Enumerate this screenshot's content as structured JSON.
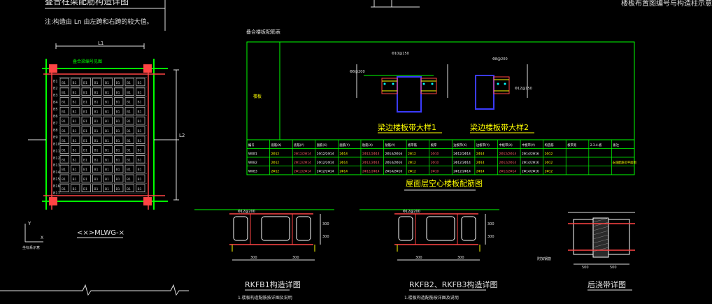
{
  "header": {
    "left_title": "叠合柱梁配筋构造详图",
    "left_note": "注:构造由 Ln 由左跨和右跨的较大值。",
    "right_title": "楼板布置图编号与构造柱示意图"
  },
  "left_plan": {
    "dim_top": "L1",
    "dim_side": "L2",
    "beam_label": "叠合梁编号见图",
    "caption": "<×>MLWG-×",
    "axis_y": "Y",
    "axis_x": "X",
    "axis_caption": "坐标系示意",
    "row_labels": [
      "B1",
      "B2",
      "B3",
      "B4",
      "B5",
      "B6",
      "B7",
      "B8",
      "B9",
      "B10",
      "B11",
      "B12",
      "B13",
      "B14",
      "B15",
      "B16",
      "B17"
    ],
    "cell_mark": "B1"
  },
  "table": {
    "caption": "叠合楼板配筋表",
    "left_cell": "楼板",
    "detail1_caption": "梁边楼板带大样1",
    "detail2_caption": "梁边楼板带大样2",
    "detail_notes": [
      "Φ8@200",
      "Φ10@150",
      "Φ12@150",
      "Φ8@200"
    ],
    "title": "屋面层空心楼板配筋图",
    "header_cells": [
      "编号",
      "底筋(X)",
      "底筋(Y)",
      "面筋(X)",
      "面筋(Y)",
      "肋筋(X)",
      "肋筋(Y)",
      "板带筋",
      "板厚",
      "边板带(X)",
      "边板带(Y)",
      "中板带(X)",
      "中板带(Y)",
      "构造筋",
      "板带宽",
      "2.3.4.板",
      "备注"
    ],
    "rows": [
      [
        "WKB1",
        "2Φ12",
        "2Φ12/2Φ14",
        "2Φ12/2Φ14",
        "2Φ14",
        "2Φ12/2Φ14",
        "2Φ14/2Φ16",
        "2Φ12",
        "2Φ10",
        "2Φ12/2Φ14",
        "2Φ14",
        "2Φ12/2Φ14",
        "2Φ14/2Φ16",
        "2Φ12"
      ],
      [
        "WKB2",
        "2Φ12",
        "2Φ12/2Φ14",
        "2Φ12/2Φ14",
        "2Φ14",
        "2Φ12/2Φ14",
        "2Φ14/2Φ16",
        "2Φ12",
        "2Φ10",
        "2Φ12/2Φ14",
        "2Φ14",
        "2Φ12/2Φ14",
        "2Φ14/2Φ16",
        "2Φ12"
      ],
      [
        "WKB3",
        "2Φ12",
        "2Φ12/2Φ14",
        "2Φ12/2Φ14",
        "2Φ14",
        "2Φ12/2Φ14",
        "2Φ14/2Φ16",
        "2Φ12",
        "2Φ10",
        "2Φ12/2Φ14",
        "2Φ14",
        "2Φ12/2Φ14",
        "2Φ14/2Φ16",
        "2Φ12"
      ]
    ],
    "remark": "支座配筋见平面图"
  },
  "sections": [
    {
      "title": "RKFB1构造详图",
      "note": "1.楼板构造配筋按详图及说明",
      "dims": [
        "300",
        "300",
        "300",
        "300"
      ],
      "label": "Φ12@200"
    },
    {
      "title": "RKFB2、RKFB3构造详图",
      "note": "1.楼板构造配筋按详图及说明",
      "dims": [
        "300",
        "300",
        "300",
        "300"
      ],
      "label": "Φ12@200"
    },
    {
      "title": "后浇带详图",
      "note": "",
      "dims": [
        "500",
        "500"
      ],
      "label": "附加钢筋"
    }
  ]
}
